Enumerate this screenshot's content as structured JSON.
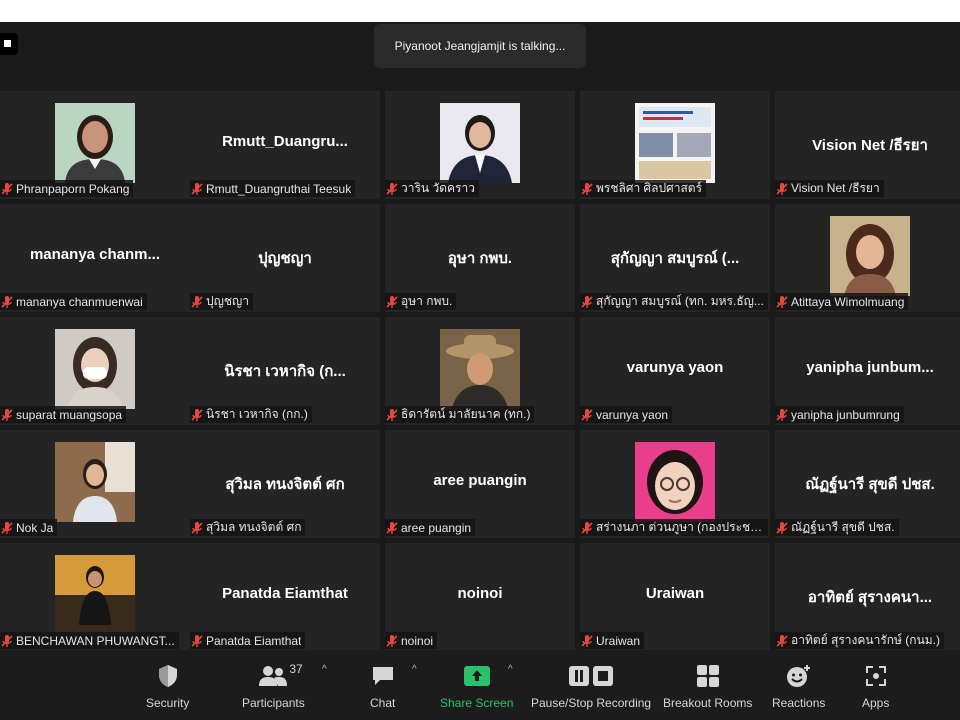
{
  "status": {
    "talking": "Piyanoot Jeangjamjit is talking..."
  },
  "tiles": [
    {
      "big": "",
      "label": "Phranpaporn Pokang",
      "photo": "woman-short-dark-hair"
    },
    {
      "big": "Rmutt_Duangru...",
      "label": "Rmutt_Duangruthai Teesuk"
    },
    {
      "big": "",
      "label": "วาริน วัดคราว",
      "photo": "woman-suit"
    },
    {
      "big": "",
      "label": "พรชลิศา ศิลปศาสตร์",
      "photo": "slide-screen"
    },
    {
      "big": "Vision Net /ธีรยา",
      "label": "Vision Net /ธีรยา"
    },
    {
      "big": "mananya  chanm...",
      "label": "mananya chanmuenwai"
    },
    {
      "big": "ปุญชญา",
      "label": "ปุญชญา"
    },
    {
      "big": "อุษา กพบ.",
      "label": "อุษา กพบ."
    },
    {
      "big": "สุกัญญา สมบูรณ์ (...",
      "label": "สุกัญญา สมบูรณ์ (ทก. มหร.ธัญ..."
    },
    {
      "big": "",
      "label": "Atittaya Wimolmuang",
      "photo": "woman-long-hair"
    },
    {
      "big": "",
      "label": "suparat muangsopa",
      "photo": "woman-mask"
    },
    {
      "big": "นิรชา  เวหากิจ (ก...",
      "label": "นิรชา  เวหากิจ (กก.)"
    },
    {
      "big": "",
      "label": "ธิดารัตน์  มาลัยนาค (ทก.)",
      "photo": "woman-hat"
    },
    {
      "big": "varunya  yaon",
      "label": "varunya  yaon"
    },
    {
      "big": "yanipha  junbum...",
      "label": "yanipha junbumrung"
    },
    {
      "big": "",
      "label": "Nok Ja",
      "photo": "woman-indoor"
    },
    {
      "big": "สุวิมล ทนงจิตต์ ศก",
      "label": "สุวิมล ทนงจิตต์ ศก"
    },
    {
      "big": "aree puangin",
      "label": "aree puangin"
    },
    {
      "big": "",
      "label": "สร่างนภา ต่วนภูษา (กองประชาสั...",
      "photo": "woman-glasses"
    },
    {
      "big": "ณัฏฐ์นารี สุขดี ปชส.",
      "label": "ณัฏฐ์นารี สุขดี ปชส."
    },
    {
      "big": "",
      "label": "BENCHAWAN PHUWANGT...",
      "photo": "woman-sitting"
    },
    {
      "big": "Panatda Eiamthat",
      "label": "Panatda Eiamthat"
    },
    {
      "big": "noinoi",
      "label": "noinoi"
    },
    {
      "big": "Uraiwan",
      "label": "Uraiwan"
    },
    {
      "big": "อาทิตย์ สุรางคนา...",
      "label": "อาทิตย์ สุรางคนารักษ์ (กนม.)"
    }
  ],
  "toolbar": {
    "security": "Security",
    "participants": "Participants",
    "participants_count": "37",
    "chat": "Chat",
    "share": "Share Screen",
    "record": "Pause/Stop Recording",
    "breakout": "Breakout Rooms",
    "reactions": "Reactions",
    "apps": "Apps"
  },
  "colors": {
    "share_green": "#27c26b",
    "muted_red": "#e5483f",
    "tile_bg": "#242424"
  }
}
